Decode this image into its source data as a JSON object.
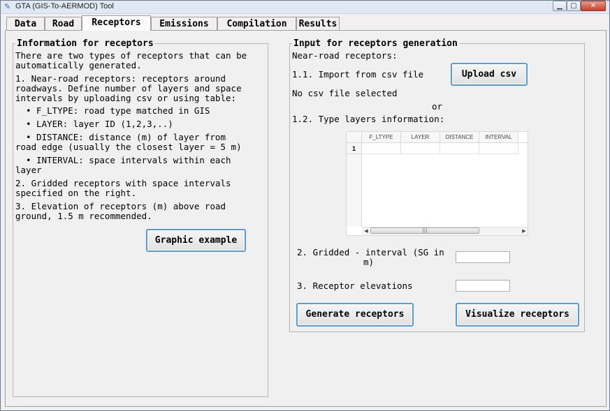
{
  "window": {
    "title": "GTA (GIS-To-AERMOD) Tool"
  },
  "tabs": [
    {
      "label": "Data"
    },
    {
      "label": "Road"
    },
    {
      "label": "Receptors"
    },
    {
      "label": "Emissions"
    },
    {
      "label": "Compilation"
    },
    {
      "label": "Results"
    }
  ],
  "info": {
    "title": "Information for receptors",
    "lines": [
      "There are two types of receptors that can be",
      "automatically generated.",
      "1. Near-road receptors: receptors around",
      "roadways. Define number of layers and space",
      "intervals by uploading csv or using table:",
      "• F_LTYPE: road type matched in GIS",
      "• LAYER: layer ID (1,2,3,..)",
      "• DISTANCE: distance (m) of layer from",
      "road edge (usually the closest layer = 5 m)",
      "• INTERVAL: space intervals within each",
      "layer",
      "2. Gridded receptors with space intervals",
      "specified on the right.",
      "3. Elevation of receptors (m) above road",
      "ground, 1.5 m recommended."
    ],
    "graphic_button": "Graphic example"
  },
  "input": {
    "title": "Input for receptors generation",
    "near_road_label": "Near-road receptors:",
    "import_label": "1.1. Import from csv file",
    "upload_button": "Upload csv",
    "csv_status": "No csv file selected",
    "or_label": "or",
    "type_layers_label": "1.2. Type layers information:",
    "table": {
      "columns": [
        "F_LTYPE",
        "LAYER",
        "DISTANCE",
        "INTERVAL"
      ],
      "row_numbers": [
        "1"
      ],
      "rows": [
        [
          "",
          "",
          "",
          ""
        ]
      ]
    },
    "gridded_label_line1": "2. Gridded - interval (SG in",
    "gridded_label_line2": "m)",
    "gridded_value": "",
    "elevation_label": "3. Receptor elevations",
    "elevation_value": "",
    "generate_button": "Generate receptors",
    "visualize_button": "Visualize receptors"
  }
}
